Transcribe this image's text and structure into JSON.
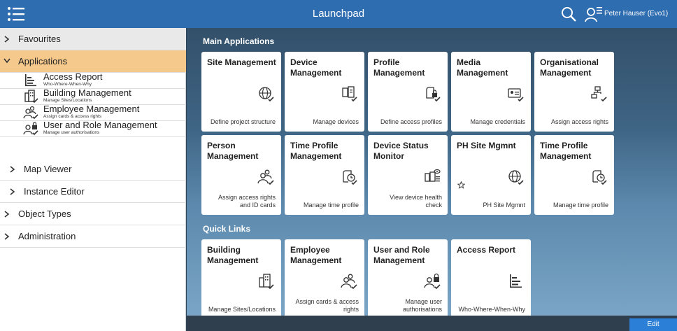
{
  "header": {
    "title": "Launchpad",
    "menu_icon": "menu-list-icon",
    "search_icon": "search-icon",
    "user_icon": "user-settings-icon",
    "user_name": "Peter Hauser (Evo1)"
  },
  "sidebar": {
    "favourites": "Favourites",
    "applications": "Applications",
    "apps": [
      {
        "title": "Access Report",
        "subtitle": "Who-Where-When-Why",
        "icon": "access-report-icon"
      },
      {
        "title": "Building Management",
        "subtitle": "Manage Sites/Locations",
        "icon": "building-management-icon"
      },
      {
        "title": "Employee Management",
        "subtitle": "Assign cards & access rights",
        "icon": "employee-management-icon"
      },
      {
        "title": "User and Role Management",
        "subtitle": "Manage user authorisations",
        "icon": "user-role-management-icon"
      }
    ],
    "map_viewer": "Map Viewer",
    "instance_editor": "Instance Editor",
    "object_types": "Object Types",
    "administration": "Administration"
  },
  "main": {
    "main_apps_title": "Main Applications",
    "quick_links_title": "Quick Links",
    "tiles": [
      {
        "title": "Site Management",
        "subtitle": "Define project structure",
        "icon": "globe-check-icon"
      },
      {
        "title": "Device Management",
        "subtitle": "Manage devices",
        "icon": "device-manage-icon"
      },
      {
        "title": "Profile Management",
        "subtitle": "Define access profiles",
        "icon": "profile-lock-icon"
      },
      {
        "title": "Media Management",
        "subtitle": "Manage credentials",
        "icon": "credential-card-icon"
      },
      {
        "title": "Organisational Management",
        "subtitle": "Assign access rights",
        "icon": "org-chart-icon"
      },
      {
        "title": "Person Management",
        "subtitle": "Assign access rights and ID cards",
        "icon": "persons-check-icon"
      },
      {
        "title": "Time Profile Management",
        "subtitle": "Manage time profile",
        "icon": "time-profile-icon"
      },
      {
        "title": "Device Status Monitor",
        "subtitle": "View device health check",
        "icon": "device-status-icon"
      },
      {
        "title": "PH Site Mgmnt",
        "subtitle": "PH Site Mgmnt",
        "icon": "globe-check-icon",
        "star_icon": "star-outline-icon"
      },
      {
        "title": "Time Profile Management",
        "subtitle": "Manage time profile",
        "icon": "time-profile-icon"
      }
    ],
    "quick_links": [
      {
        "title": "Building Management",
        "subtitle": "Manage Sites/Locations",
        "icon": "building-management-icon"
      },
      {
        "title": "Employee Management",
        "subtitle": "Assign cards & access rights",
        "icon": "persons-check-icon"
      },
      {
        "title": "User and Role Management",
        "subtitle": "Manage user authorisations",
        "icon": "user-role-management-icon"
      },
      {
        "title": "Access Report",
        "subtitle": "Who-Where-When-Why",
        "icon": "access-report-icon"
      }
    ]
  },
  "footer": {
    "edit_label": "Edit"
  },
  "colors": {
    "header_bg": "#2e6db0",
    "active_nav_bg": "#f5c98c",
    "edit_button_bg": "#2c7fd6"
  }
}
